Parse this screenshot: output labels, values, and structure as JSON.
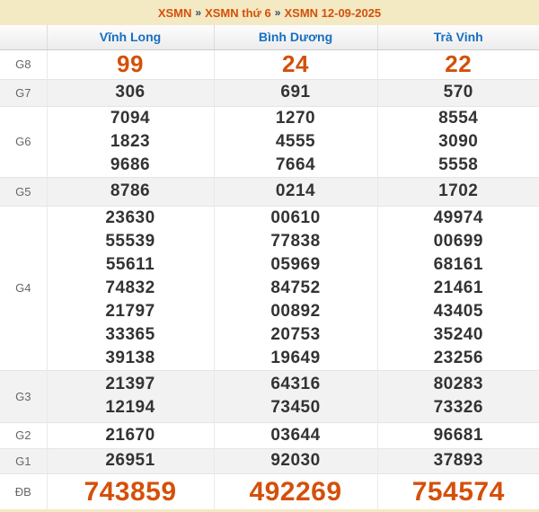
{
  "breadcrumb": {
    "separator": "»",
    "items": [
      "XSMN",
      "XSMN thứ 6",
      "XSMN 12-09-2025"
    ]
  },
  "colors": {
    "page_background": "#f3e9c3",
    "accent_orange": "#d4500a",
    "header_blue": "#176fc1",
    "separator_navy": "#30486e",
    "number_dark": "#333333",
    "label_gray": "#666666",
    "stripe_gray": "#f2f2f2"
  },
  "table": {
    "columns": [
      "Vĩnh Long",
      "Bình Dương",
      "Trà Vinh"
    ],
    "rows": [
      {
        "label": "G8",
        "highlight": true,
        "cells": [
          [
            "99"
          ],
          [
            "24"
          ],
          [
            "22"
          ]
        ]
      },
      {
        "label": "G7",
        "highlight": false,
        "cells": [
          [
            "306"
          ],
          [
            "691"
          ],
          [
            "570"
          ]
        ]
      },
      {
        "label": "G6",
        "highlight": false,
        "cells": [
          [
            "7094",
            "1823",
            "9686"
          ],
          [
            "1270",
            "4555",
            "7664"
          ],
          [
            "8554",
            "3090",
            "5558"
          ]
        ]
      },
      {
        "label": "G5",
        "highlight": false,
        "cells": [
          [
            "8786"
          ],
          [
            "0214"
          ],
          [
            "1702"
          ]
        ]
      },
      {
        "label": "G4",
        "highlight": false,
        "cells": [
          [
            "23630",
            "55539",
            "55611",
            "74832",
            "21797",
            "33365",
            "39138"
          ],
          [
            "00610",
            "77838",
            "05969",
            "84752",
            "00892",
            "20753",
            "19649"
          ],
          [
            "49974",
            "00699",
            "68161",
            "21461",
            "43405",
            "35240",
            "23256"
          ]
        ]
      },
      {
        "label": "G3",
        "highlight": false,
        "cells": [
          [
            "21397",
            "12194"
          ],
          [
            "64316",
            "73450"
          ],
          [
            "80283",
            "73326"
          ]
        ]
      },
      {
        "label": "G2",
        "highlight": false,
        "cells": [
          [
            "21670"
          ],
          [
            "03644"
          ],
          [
            "96681"
          ]
        ]
      },
      {
        "label": "G1",
        "highlight": false,
        "cells": [
          [
            "26951"
          ],
          [
            "92030"
          ],
          [
            "37893"
          ]
        ]
      },
      {
        "label": "ĐB",
        "highlight": true,
        "cells": [
          [
            "743859"
          ],
          [
            "492269"
          ],
          [
            "754574"
          ]
        ]
      }
    ]
  }
}
